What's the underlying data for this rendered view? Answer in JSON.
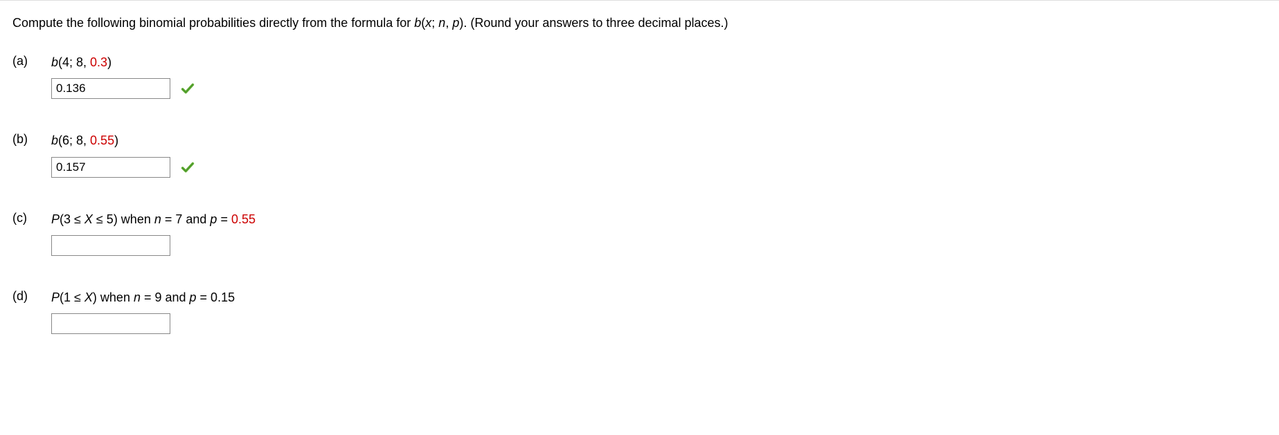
{
  "instructions": {
    "pre": "Compute the following binomial probabilities directly from the formula for ",
    "b": "b",
    "open": "(",
    "x": "x",
    "sep1": "; ",
    "n": "n",
    "sep2": ", ",
    "p": "p",
    "close": "). (Round your answers to three decimal places.)"
  },
  "parts": {
    "a": {
      "label": "(a)",
      "b": "b",
      "open": "(4; 8, ",
      "pval": "0.3",
      "close": ")",
      "answer": "0.136",
      "correct": true
    },
    "b": {
      "label": "(b)",
      "b": "b",
      "open": "(6; 8, ",
      "pval": "0.55",
      "close": ")",
      "answer": "0.157",
      "correct": true
    },
    "c": {
      "label": "(c)",
      "P": "P",
      "open": "(3 ≤ ",
      "X": "X",
      "mid": " ≤ 5) when ",
      "n": "n",
      "eq1": " = 7 and ",
      "p": "p",
      "eq2": " = ",
      "pval": "0.55",
      "answer": ""
    },
    "d": {
      "label": "(d)",
      "P": "P",
      "open": "(1 ≤ ",
      "X": "X",
      "mid": ") when ",
      "n": "n",
      "eq1": " = 9 and ",
      "p": "p",
      "eq2": " = 0.15",
      "answer": ""
    }
  }
}
